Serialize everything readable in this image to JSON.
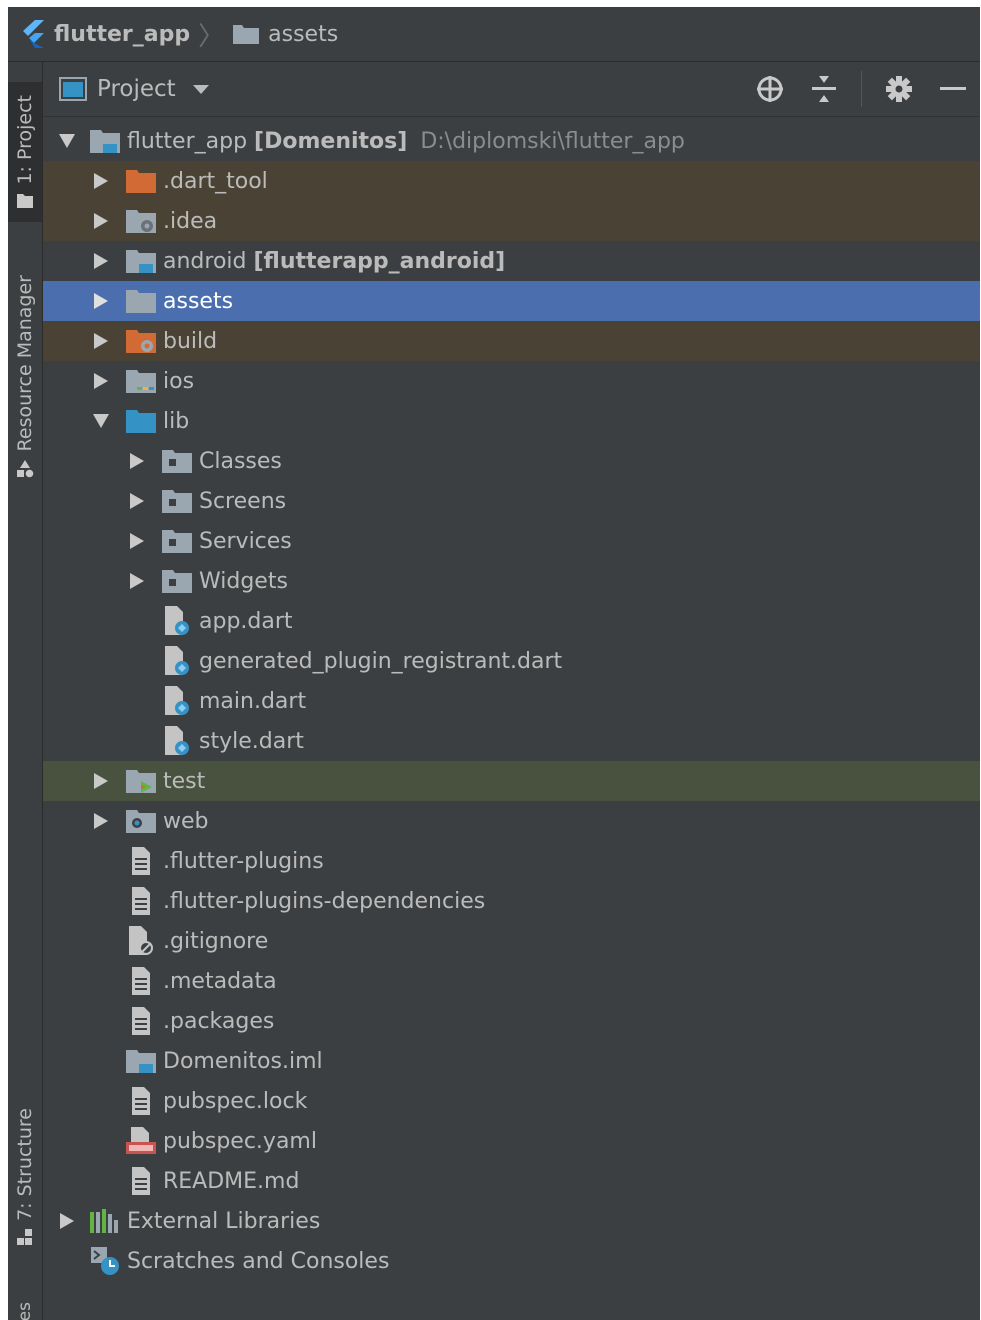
{
  "breadcrumb": {
    "project": "flutter_app",
    "folder": "assets"
  },
  "strip": {
    "project_tab": "1: Project",
    "resource_tab": "Resource Manager",
    "structure_tab": "7: Structure",
    "bottom_tab": "es"
  },
  "panel": {
    "title": "Project"
  },
  "tree": {
    "root_name": "flutter_app",
    "root_module": "[Domenitos]",
    "root_path": "D:\\diplomski\\flutter_app",
    "items": [
      "flutter_app",
      ".dart_tool",
      ".idea",
      "android",
      "assets",
      "build",
      "ios",
      "lib",
      "Classes",
      "Screens",
      "Services",
      "Widgets",
      "app.dart",
      "generated_plugin_registrant.dart",
      "main.dart",
      "style.dart",
      "test",
      "web",
      ".flutter-plugins",
      ".flutter-plugins-dependencies",
      ".gitignore",
      ".metadata",
      ".packages",
      "Domenitos.iml",
      "pubspec.lock",
      "pubspec.yaml",
      "README.md",
      "External Libraries",
      "Scratches and Consoles"
    ],
    "android_module": "[flutterapp_android]"
  },
  "colors": {
    "background": "#3c3f41",
    "selection": "#4b6eaf",
    "excluded": "#4a4335",
    "test_sources": "#48523f",
    "folder": "#9aa7b0",
    "excluded_folder": "#d16a34",
    "flutter_blue": "#42a5f5"
  },
  "icons": {
    "flutter": "flutter-logo-icon",
    "folder": "folder-icon",
    "locate": "crosshair-icon",
    "collapse": "collapse-all-icon",
    "settings": "gear-icon",
    "hide": "minimize-icon"
  }
}
